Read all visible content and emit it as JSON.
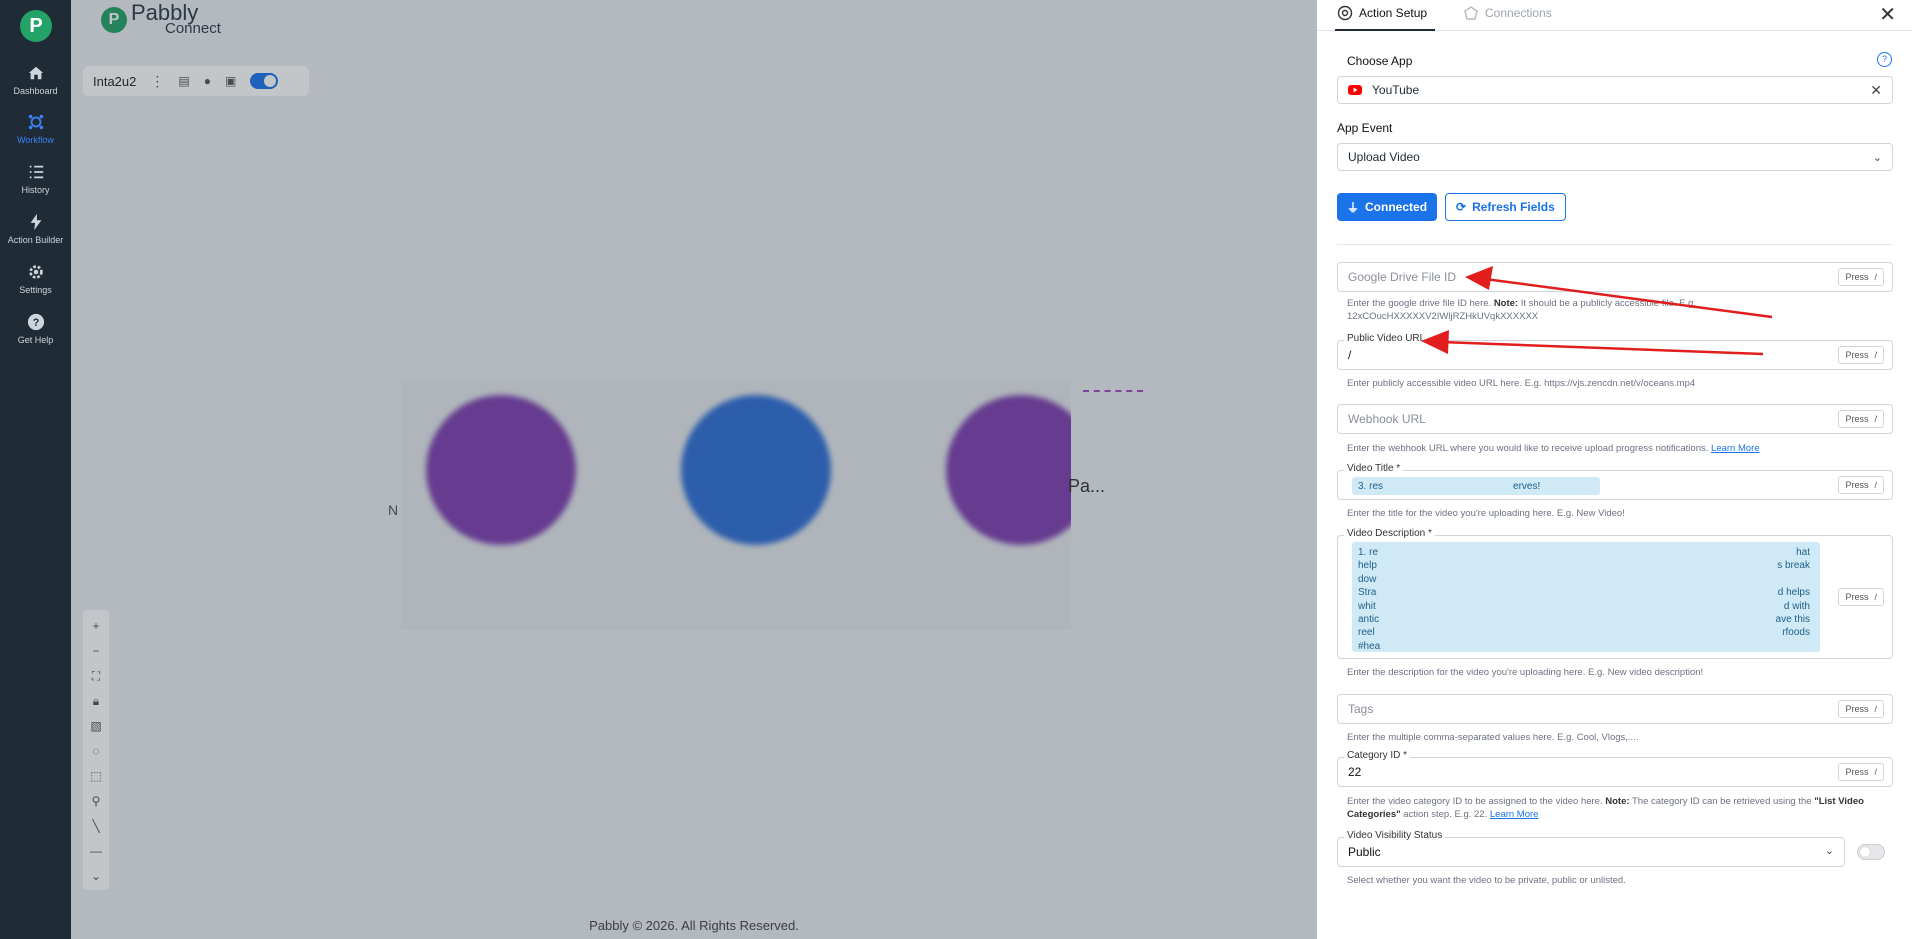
{
  "sidebar": {
    "logo": "P",
    "items": [
      {
        "label": "Dashboard",
        "icon": "home-icon"
      },
      {
        "label": "Workflow",
        "icon": "workflow-icon",
        "active": true
      },
      {
        "label": "History",
        "icon": "history-icon"
      },
      {
        "label": "Action Builder",
        "icon": "bolt-icon"
      },
      {
        "label": "Settings",
        "icon": "gear-icon"
      },
      {
        "label": "Get Help",
        "icon": "help-icon"
      }
    ]
  },
  "brand": {
    "name": "Pabbly",
    "product": "Connect"
  },
  "workflow": {
    "name": "Inta2u2"
  },
  "canvas": {
    "partial_label_left": "N",
    "partial_label_right": "Pa..."
  },
  "footer": "Pabbly © 2026. All Rights Reserved.",
  "panel": {
    "tabs": {
      "active": "Action Setup",
      "inactive": "Connections"
    },
    "choose_app_label": "Choose App",
    "app": "YouTube",
    "app_event_label": "App Event",
    "app_event": "Upload Video",
    "connected_btn": "Connected",
    "refresh_btn": "Refresh Fields",
    "press": "Press",
    "slash": "/",
    "gdrive": {
      "placeholder": "Google Drive File ID",
      "help1": "Enter the google drive file ID here.",
      "note": "Note:",
      "help2": "It should be a publicly accessible file. E.g.",
      "help3": "12xCOucHXXXXXV2IWljRZHkUVqkXXXXXX"
    },
    "public_url": {
      "label": "Public Video URL",
      "value": "/",
      "help": "Enter publicly accessible video URL here. E.g. https://vjs.zencdn.net/v/oceans.mp4"
    },
    "webhook": {
      "placeholder": "Webhook URL",
      "help": "Enter the webhook URL where you would like to receive upload progress notifications.",
      "link": "Learn More"
    },
    "video_title": {
      "label": "Video Title *",
      "chip_start": "3. res",
      "chip_end": "erves!",
      "help": "Enter the title for the video you're uploading here. E.g. New Video!"
    },
    "video_desc": {
      "label": "Video Description *",
      "lines": [
        "1. re",
        "help",
        "dow",
        "Stra",
        "whit",
        "antic",
        "reel",
        "#hea"
      ],
      "right_lines": [
        "hat",
        "s break",
        "",
        "d helps",
        "d with",
        "ave this",
        "rfoods"
      ],
      "help": "Enter the description for the video you're uploading here. E.g. New video description!"
    },
    "tags": {
      "placeholder": "Tags",
      "help": "Enter the multiple comma-separated values here. E.g. Cool, Vlogs,...."
    },
    "category": {
      "label": "Category ID *",
      "value": "22",
      "help1": "Enter the video category ID to be assigned to the video here.",
      "note": "Note:",
      "help2": "The category ID can be retrieved using the",
      "help3": "\"List Video Categories\"",
      "help4": "action step. E.g. 22.",
      "link": "Learn More"
    },
    "visibility": {
      "label": "Video Visibility Status",
      "value": "Public",
      "help": "Select whether you want the video to be private, public or unlisted."
    }
  },
  "colors": {
    "primary": "#1a73e8",
    "youtube": "#ff0000",
    "annotation_arrow": "#e11d1d"
  }
}
